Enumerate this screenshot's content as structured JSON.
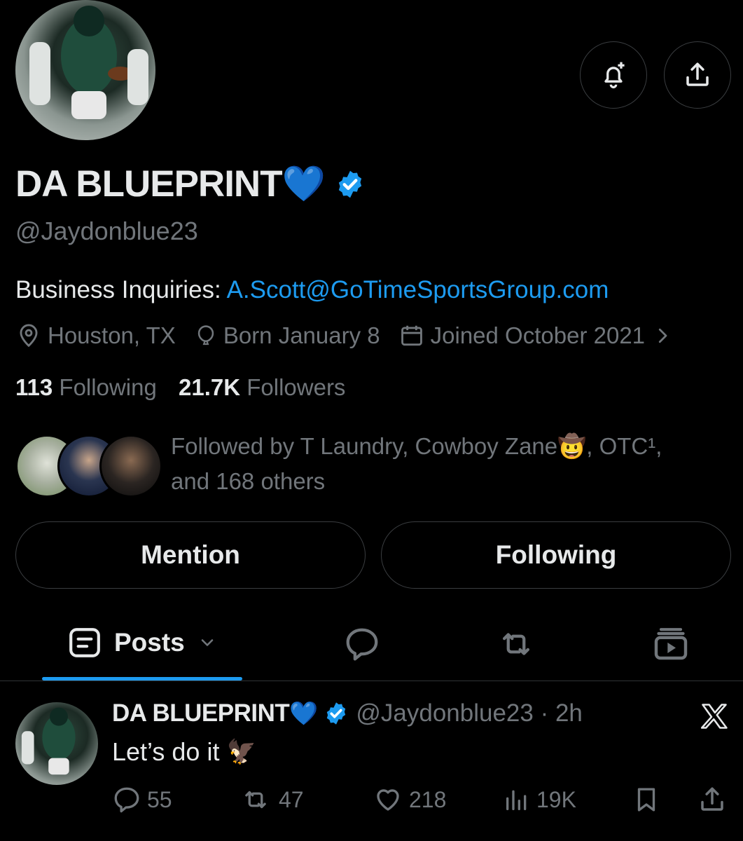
{
  "profile": {
    "display_name": "DA BLUEPRINT",
    "name_emoji": "💙",
    "verified": true,
    "handle": "@Jaydonblue23",
    "bio_prefix": "Business Inquiries: ",
    "bio_email": "A.Scott@GoTimeSportsGroup.com",
    "location": "Houston, TX",
    "birthday": "Born January 8",
    "joined": "Joined October 2021",
    "following_count": "113",
    "following_label": "Following",
    "followers_count": "21.7K",
    "followers_label": "Followers",
    "followed_by_line1": "Followed by T Laundry, Cowboy Zane🤠, OTC¹,",
    "followed_by_line2": "and 168 others"
  },
  "buttons": {
    "mention": "Mention",
    "following": "Following"
  },
  "tabs": {
    "posts_label": "Posts"
  },
  "post": {
    "author_name": "DA BLUEPRINT",
    "author_emoji": "💙",
    "author_handle_time": "@Jaydonblue23 · 2h",
    "text": "Let’s do it",
    "text_emoji": "🦅",
    "replies": "55",
    "reposts": "47",
    "likes": "218",
    "views": "19K"
  },
  "colors": {
    "background": "#000000",
    "primary_text": "#e7e9ea",
    "secondary_text": "#71767b",
    "accent": "#1d9bf0",
    "border": "#3a3d40"
  }
}
